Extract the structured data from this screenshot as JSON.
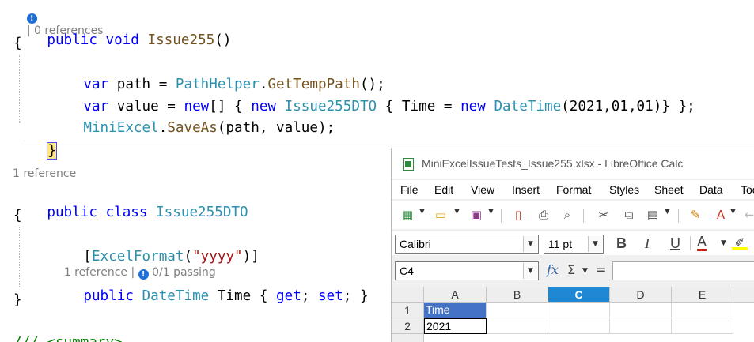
{
  "editor": {
    "top_lens": {
      "text": "| 0 references"
    },
    "method_signature": {
      "kw1": "public",
      "kw2": "void",
      "name": "Issue255",
      "parens": "()"
    },
    "open_brace_1": "{",
    "line_path": {
      "kw": "var",
      "rest": " path = ",
      "type": "PathHelper",
      "dot": ".",
      "method": "GetTempPath",
      "end": "();"
    },
    "line_value": {
      "kw": "var",
      "rest": " value = ",
      "new1": "new",
      "arr": "[] { ",
      "new2": "new",
      "dto": "Issue255DTO",
      "init": " { Time = ",
      "new3": "new",
      "dt": "DateTime",
      "args": "(2021,01,01)} };"
    },
    "line_save": {
      "type": "MiniExcel",
      "dot": ".",
      "method": "SaveAs",
      "args": "(path, value);"
    },
    "close_brace_1": "}",
    "class_lens": "1 reference",
    "class_signature": {
      "kw1": "public",
      "kw2": "class",
      "name": "Issue255DTO"
    },
    "open_brace_2": "{",
    "attribute": {
      "open": "[",
      "name": "ExcelFormat",
      "paren": "(",
      "value": "\"yyyy\"",
      "close": ")]"
    },
    "prop_lens": {
      "refs": "1 reference",
      "sep": "|",
      "passing": "0/1 passing"
    },
    "property": {
      "kw": "public",
      "type": "DateTime",
      "name": " Time { ",
      "get": "get",
      "semi1": "; ",
      "set": "set",
      "semi2": "; }"
    },
    "close_brace_2": "}",
    "summary": "/// <summary>"
  },
  "calc": {
    "title": "MiniExcelIssueTests_Issue255.xlsx - LibreOffice Calc",
    "menu": [
      "File",
      "Edit",
      "View",
      "Insert",
      "Format",
      "Styles",
      "Sheet",
      "Data",
      "Tools"
    ],
    "font_name": "Calibri",
    "font_size": "11 pt",
    "name_box": "C4",
    "format_buttons": {
      "bold": "B",
      "italic": "I",
      "underline": "U",
      "font_color": "A"
    },
    "fx": "fx",
    "sum": "Σ",
    "equals": "=",
    "columns": [
      "A",
      "B",
      "C",
      "D",
      "E"
    ],
    "active_column": "C",
    "rows": [
      "1",
      "2"
    ],
    "cells": {
      "A1": "Time",
      "A2": "2021"
    },
    "accent_color": "#1e88d4",
    "header_fill_color": "#4472c4"
  }
}
